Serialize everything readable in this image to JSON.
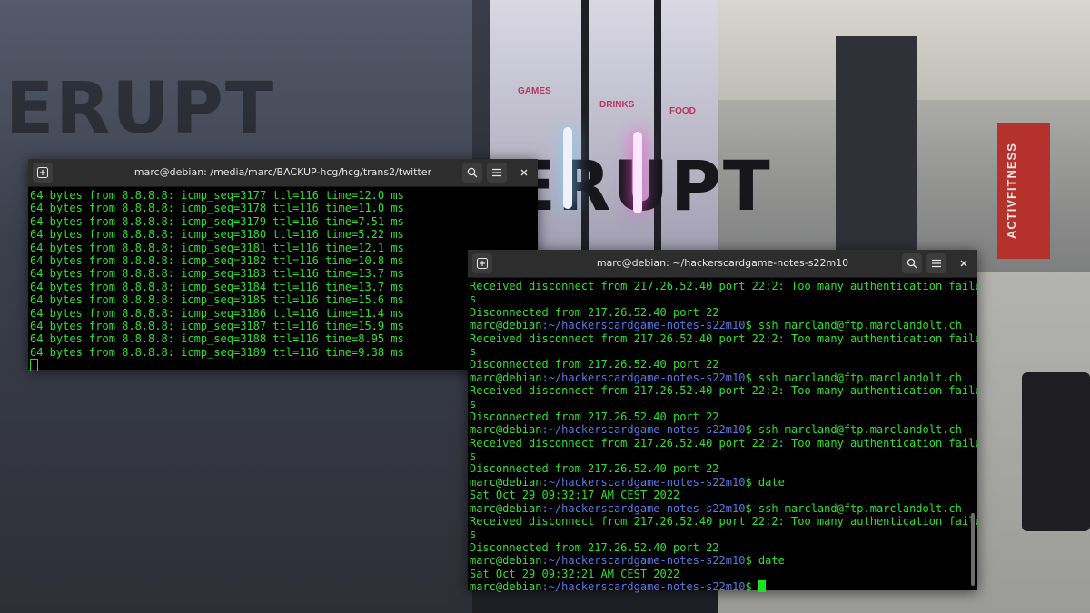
{
  "background": {
    "sign_text": "ACTIVFITNESS",
    "shop_labels": [
      "GAMES",
      "DRINKS",
      "FOOD"
    ],
    "logo_text": "ERUPT"
  },
  "terminal1": {
    "title": "marc@debian: /media/marc/BACKUP-hcg/hcg/trans2/twitter",
    "new_tab_icon": "new-tab-icon",
    "lines": [
      "64 bytes from 8.8.8.8: icmp_seq=3177 ttl=116 time=12.0 ms",
      "64 bytes from 8.8.8.8: icmp_seq=3178 ttl=116 time=11.0 ms",
      "64 bytes from 8.8.8.8: icmp_seq=3179 ttl=116 time=7.51 ms",
      "64 bytes from 8.8.8.8: icmp_seq=3180 ttl=116 time=5.22 ms",
      "64 bytes from 8.8.8.8: icmp_seq=3181 ttl=116 time=12.1 ms",
      "64 bytes from 8.8.8.8: icmp_seq=3182 ttl=116 time=10.8 ms",
      "64 bytes from 8.8.8.8: icmp_seq=3183 ttl=116 time=13.7 ms",
      "64 bytes from 8.8.8.8: icmp_seq=3184 ttl=116 time=13.7 ms",
      "64 bytes from 8.8.8.8: icmp_seq=3185 ttl=116 time=15.6 ms",
      "64 bytes from 8.8.8.8: icmp_seq=3186 ttl=116 time=11.4 ms",
      "64 bytes from 8.8.8.8: icmp_seq=3187 ttl=116 time=15.9 ms",
      "64 bytes from 8.8.8.8: icmp_seq=3188 ttl=116 time=8.95 ms",
      "64 bytes from 8.8.8.8: icmp_seq=3189 ttl=116 time=9.38 ms"
    ]
  },
  "terminal2": {
    "title": "marc@debian: ~/hackerscardgame-notes-s22m10",
    "user_host": "marc@debian",
    "path": ":~/hackerscardgame-notes-s22m10",
    "lines": [
      {
        "kind": "out",
        "text": "Received disconnect from 217.26.52.40 port 22:2: Too many authentication failure"
      },
      {
        "kind": "out",
        "text": "s"
      },
      {
        "kind": "out",
        "text": "Disconnected from 217.26.52.40 port 22"
      },
      {
        "kind": "cmd",
        "text": "$ ssh marcland@ftp.marclandolt.ch"
      },
      {
        "kind": "out",
        "text": "Received disconnect from 217.26.52.40 port 22:2: Too many authentication failure"
      },
      {
        "kind": "out",
        "text": "s"
      },
      {
        "kind": "out",
        "text": "Disconnected from 217.26.52.40 port 22"
      },
      {
        "kind": "cmd",
        "text": "$ ssh marcland@ftp.marclandolt.ch"
      },
      {
        "kind": "out",
        "text": "Received disconnect from 217.26.52.40 port 22:2: Too many authentication failure"
      },
      {
        "kind": "out",
        "text": "s"
      },
      {
        "kind": "out",
        "text": "Disconnected from 217.26.52.40 port 22"
      },
      {
        "kind": "cmd",
        "text": "$ ssh marcland@ftp.marclandolt.ch"
      },
      {
        "kind": "out",
        "text": "Received disconnect from 217.26.52.40 port 22:2: Too many authentication failure"
      },
      {
        "kind": "out",
        "text": "s"
      },
      {
        "kind": "out",
        "text": "Disconnected from 217.26.52.40 port 22"
      },
      {
        "kind": "cmd",
        "text": "$ date"
      },
      {
        "kind": "out",
        "text": "Sat Oct 29 09:32:17 AM CEST 2022"
      },
      {
        "kind": "cmd",
        "text": "$ ssh marcland@ftp.marclandolt.ch"
      },
      {
        "kind": "out",
        "text": "Received disconnect from 217.26.52.40 port 22:2: Too many authentication failure"
      },
      {
        "kind": "out",
        "text": "s"
      },
      {
        "kind": "out",
        "text": "Disconnected from 217.26.52.40 port 22"
      },
      {
        "kind": "cmd",
        "text": "$ date"
      },
      {
        "kind": "out",
        "text": "Sat Oct 29 09:32:21 AM CEST 2022"
      },
      {
        "kind": "prompt",
        "text": "$ "
      }
    ]
  },
  "colors": {
    "terminal_text": "#2ee02e",
    "prompt_path": "#5b78e6",
    "header_bg": "#2d2d2d"
  }
}
